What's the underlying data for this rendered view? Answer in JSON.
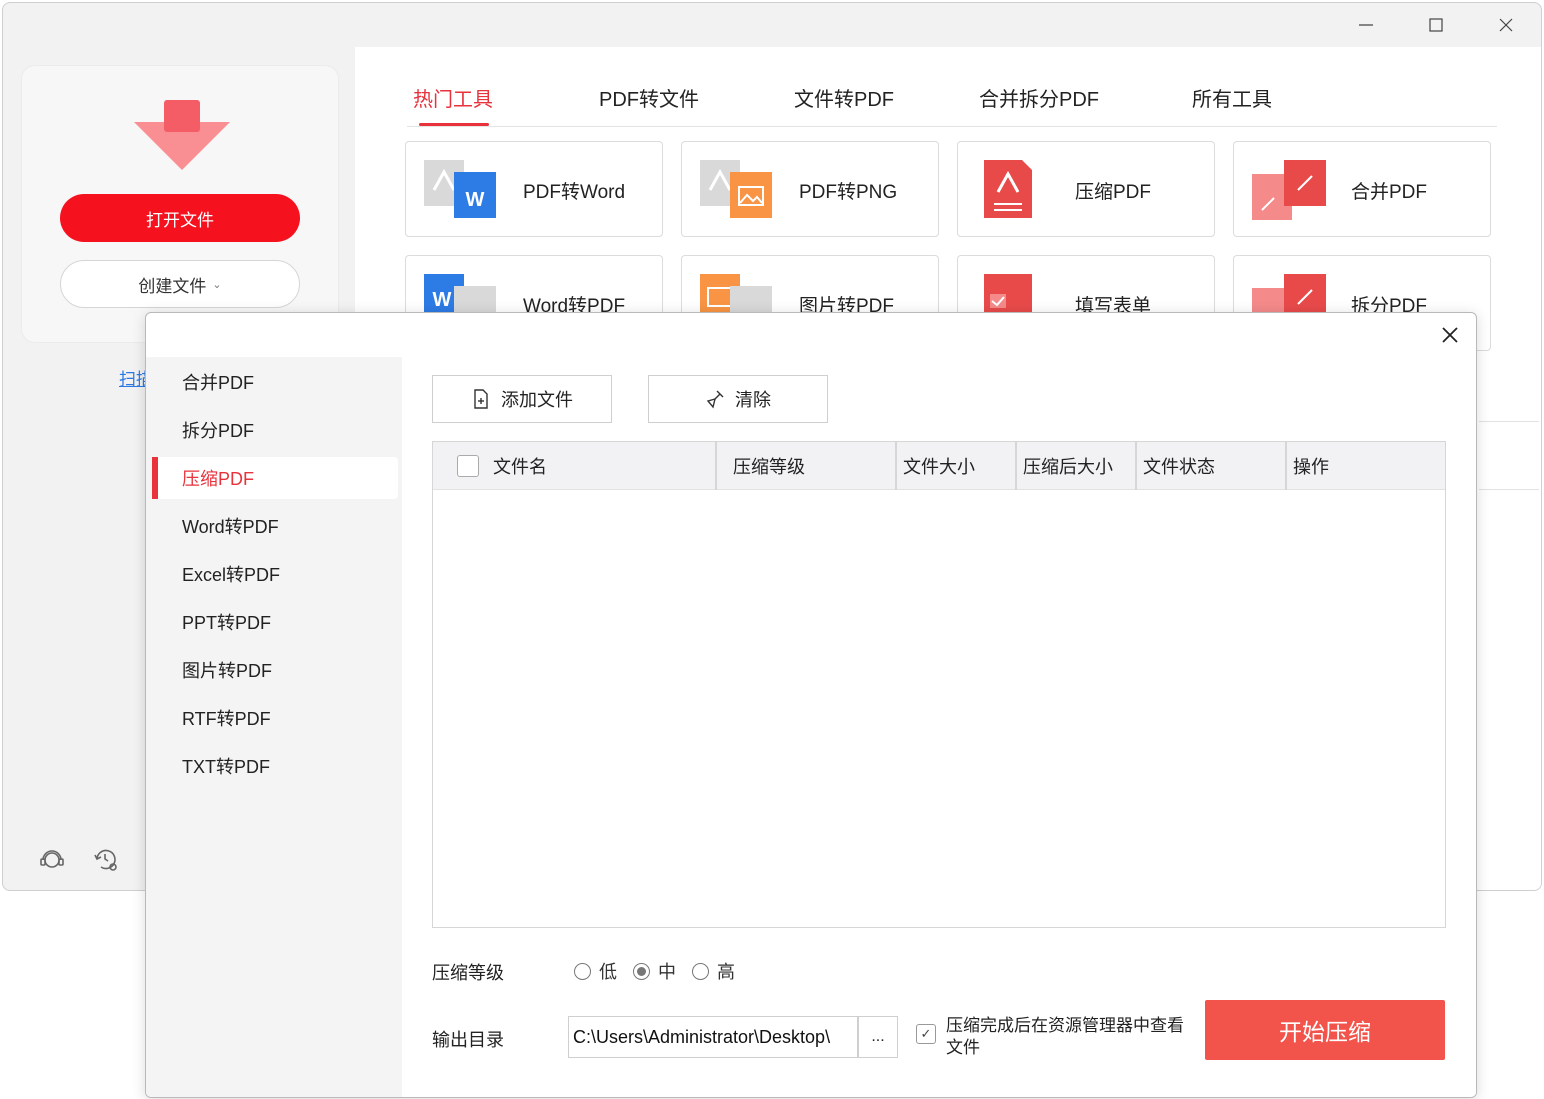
{
  "main": {
    "open_file": "打开文件",
    "create_file": "创建文件",
    "scan_link": "扫描",
    "tabs": [
      "热门工具",
      "PDF转文件",
      "文件转PDF",
      "合并拆分PDF",
      "所有工具"
    ],
    "tools": [
      {
        "label": "PDF转Word",
        "icon": "pdf-to-word-icon"
      },
      {
        "label": "PDF转PNG",
        "icon": "pdf-to-png-icon"
      },
      {
        "label": "压缩PDF",
        "icon": "compress-pdf-icon"
      },
      {
        "label": "合并PDF",
        "icon": "merge-pdf-icon"
      },
      {
        "label": "Word转PDF",
        "icon": "word-to-pdf-icon"
      },
      {
        "label": "图片转PDF",
        "icon": "image-to-pdf-icon"
      },
      {
        "label": "填写表单",
        "icon": "fill-form-icon"
      },
      {
        "label": "拆分PDF",
        "icon": "split-pdf-icon"
      }
    ]
  },
  "dialog": {
    "sidebar": [
      "合并PDF",
      "拆分PDF",
      "压缩PDF",
      "Word转PDF",
      "Excel转PDF",
      "PPT转PDF",
      "图片转PDF",
      "RTF转PDF",
      "TXT转PDF"
    ],
    "active_sidebar": "压缩PDF",
    "add_files": "添加文件",
    "clear": "清除",
    "columns": [
      "文件名",
      "压缩等级",
      "文件大小",
      "压缩后大小",
      "文件状态",
      "操作"
    ],
    "level_label": "压缩等级",
    "levels": [
      "低",
      "中",
      "高"
    ],
    "selected_level": "中",
    "output_label": "输出目录",
    "output_path": "C:\\Users\\Administrator\\Desktop\\",
    "browse": "...",
    "open_after": "压缩完成后在资源管理器中查看文件",
    "open_after_checked": true,
    "start": "开始压缩"
  },
  "colors": {
    "accent": "#e8323c",
    "primary_button": "#f5111e",
    "start_button": "#f2534b"
  }
}
